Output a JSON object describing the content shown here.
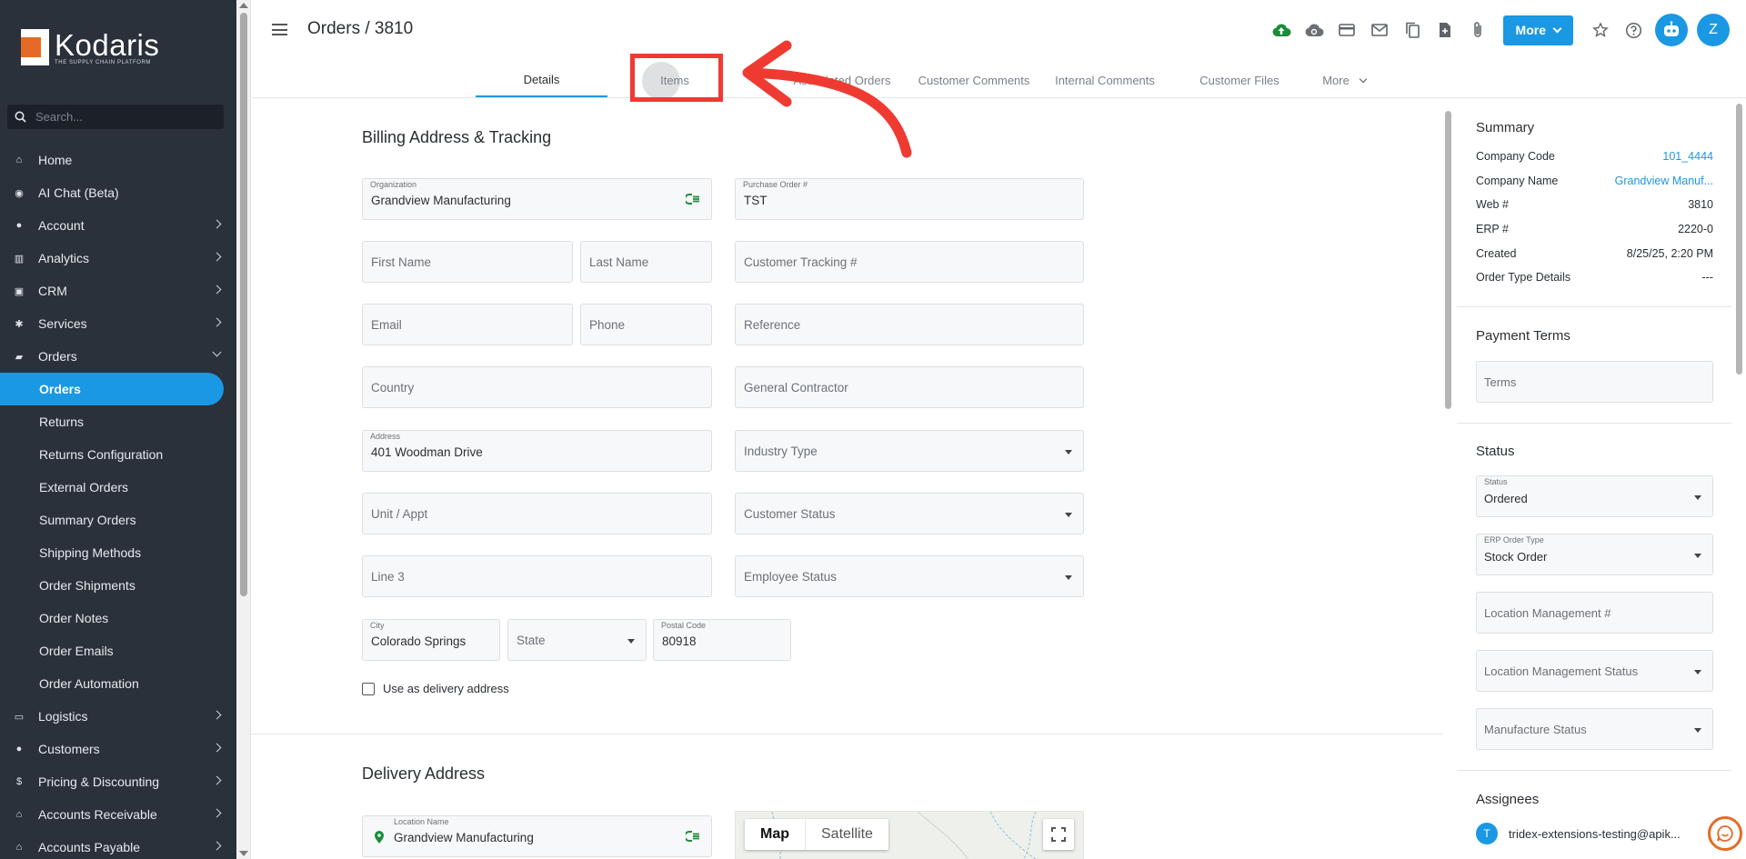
{
  "brand": {
    "name": "Kodaris",
    "tagline": "THE SUPPLY CHAIN PLATFORM"
  },
  "search": {
    "placeholder": "Search..."
  },
  "sidebar": {
    "items": [
      {
        "label": "Home",
        "icon": "home-icon"
      },
      {
        "label": "AI Chat (Beta)",
        "icon": "robot-icon"
      },
      {
        "label": "Account",
        "icon": "person-icon"
      },
      {
        "label": "Analytics",
        "icon": "chart-icon"
      },
      {
        "label": "CRM",
        "icon": "contact-card-icon"
      },
      {
        "label": "Services",
        "icon": "gears-icon"
      },
      {
        "label": "Orders",
        "icon": "truck-icon"
      }
    ],
    "orders_sub": [
      "Orders",
      "Returns",
      "Returns Configuration",
      "External Orders",
      "Summary Orders",
      "Shipping Methods",
      "Order Shipments",
      "Order Notes",
      "Order Emails",
      "Order Automation"
    ],
    "items_after": [
      {
        "label": "Logistics",
        "icon": "delivery-icon"
      },
      {
        "label": "Customers",
        "icon": "people-icon"
      },
      {
        "label": "Pricing & Discounting",
        "icon": "dollar-icon"
      },
      {
        "label": "Accounts Receivable",
        "icon": "bank-icon"
      },
      {
        "label": "Accounts Payable",
        "icon": "bank-icon"
      }
    ]
  },
  "header": {
    "title": "Orders / 3810",
    "more_label": "More",
    "user_initial": "Z"
  },
  "tabs": [
    "Details",
    "Items",
    "Associated Orders",
    "Customer Comments",
    "Internal Comments",
    "Customer Files",
    "More"
  ],
  "billing": {
    "title": "Billing Address & Tracking",
    "organization_label": "Organization",
    "organization": "Grandview Manufacturing",
    "purchase_order_label": "Purchase Order #",
    "purchase_order": "TST",
    "first_name": "First Name",
    "last_name": "Last Name",
    "customer_tracking": "Customer Tracking #",
    "email": "Email",
    "phone": "Phone",
    "reference": "Reference",
    "country": "Country",
    "general_contractor": "General Contractor",
    "address_label": "Address",
    "address": "401 Woodman Drive",
    "industry_type": "Industry Type",
    "unit": "Unit / Appt",
    "customer_status": "Customer Status",
    "line3": "Line 3",
    "employee_status": "Employee Status",
    "city_label": "City",
    "city": "Colorado Springs",
    "state": "State",
    "postal_label": "Postal Code",
    "postal": "80918",
    "use_delivery": "Use as delivery address"
  },
  "delivery": {
    "title": "Delivery Address",
    "location_label": "Location Name",
    "location": "Grandview Manufacturing",
    "map_tab": "Map",
    "satellite_tab": "Satellite"
  },
  "summary": {
    "title": "Summary",
    "rows": [
      {
        "k": "Company Code",
        "v": "101_4444"
      },
      {
        "k": "Company Name",
        "v": "Grandview Manuf..."
      },
      {
        "k": "Web #",
        "v": "3810"
      },
      {
        "k": "ERP #",
        "v": "2220-0"
      },
      {
        "k": "Created",
        "v": "8/25/25, 2:20 PM"
      },
      {
        "k": "Order Type Details",
        "v": "---"
      }
    ]
  },
  "payment": {
    "title": "Payment Terms",
    "terms": "Terms"
  },
  "status": {
    "title": "Status",
    "status_label": "Status",
    "status_value": "Ordered",
    "erp_label": "ERP Order Type",
    "erp_value": "Stock Order",
    "loc_mgmt": "Location Management #",
    "loc_mgmt_status": "Location Management Status",
    "manufacture_status": "Manufacture Status"
  },
  "assignees": {
    "title": "Assignees",
    "initial": "T",
    "email": "tridex-extensions-testing@apik..."
  },
  "colors": {
    "accent": "#1a98e3",
    "sidebar": "#2a313b",
    "annotation": "#ef3a32",
    "brand_orange": "#e46b25"
  }
}
